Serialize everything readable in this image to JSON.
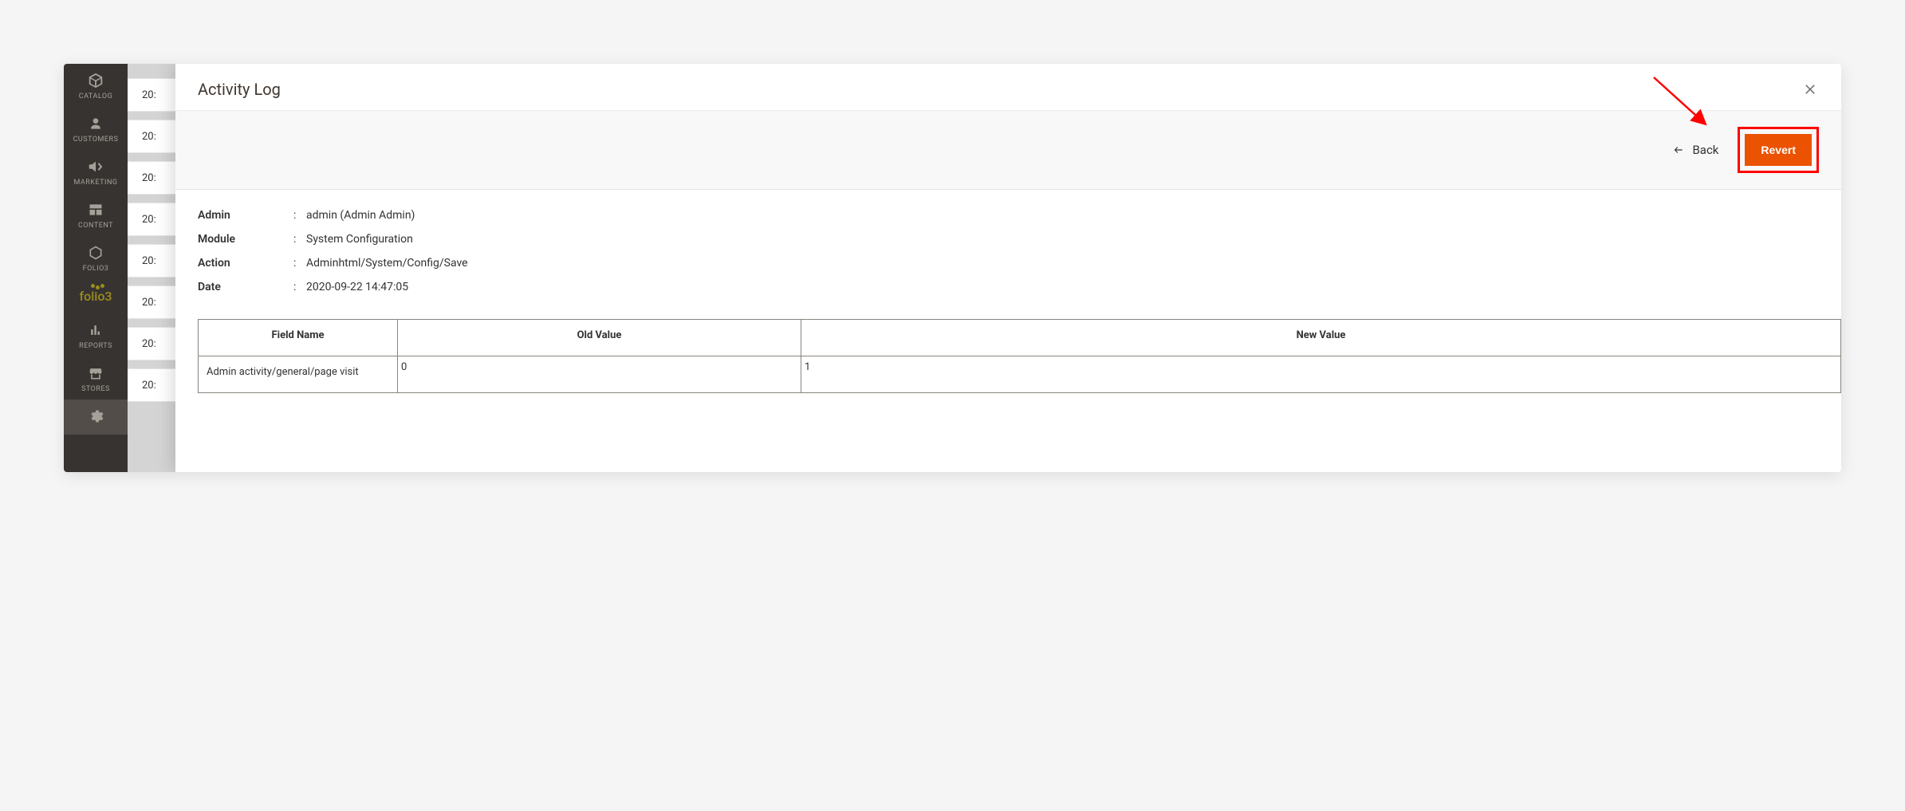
{
  "sidebar": {
    "items": [
      {
        "label": "CATALOG",
        "icon": "cube-icon"
      },
      {
        "label": "CUSTOMERS",
        "icon": "person-icon"
      },
      {
        "label": "MARKETING",
        "icon": "megaphone-icon"
      },
      {
        "label": "CONTENT",
        "icon": "layout-icon"
      },
      {
        "label": "FOLIO3",
        "icon": "hexagon-icon"
      },
      {
        "label": "folio3",
        "logo": true
      },
      {
        "label": "REPORTS",
        "icon": "chart-icon"
      },
      {
        "label": "STORES",
        "icon": "store-icon"
      },
      {
        "label": "",
        "icon": "gear-icon",
        "active": true
      }
    ]
  },
  "bg_rows": [
    "20:",
    "20:",
    "20:",
    "20:",
    "20:",
    "20:",
    "20:",
    "20:"
  ],
  "modal": {
    "title": "Activity Log",
    "back_label": "Back",
    "revert_label": "Revert"
  },
  "details": {
    "labels": {
      "admin": "Admin",
      "module": "Module",
      "action": "Action",
      "date": "Date"
    },
    "admin": "admin (Admin Admin)",
    "module": "System Configuration",
    "action": "Adminhtml/System/Config/Save",
    "date": "2020-09-22 14:47:05"
  },
  "table": {
    "headers": {
      "field": "Field Name",
      "old": "Old Value",
      "new": "New Value"
    },
    "rows": [
      {
        "field": "Admin activity/general/page visit",
        "old": "0",
        "new": "1"
      }
    ]
  },
  "colors": {
    "accent": "#eb5202",
    "highlight_border": "#ff0000",
    "sidebar_bg": "#373330"
  }
}
